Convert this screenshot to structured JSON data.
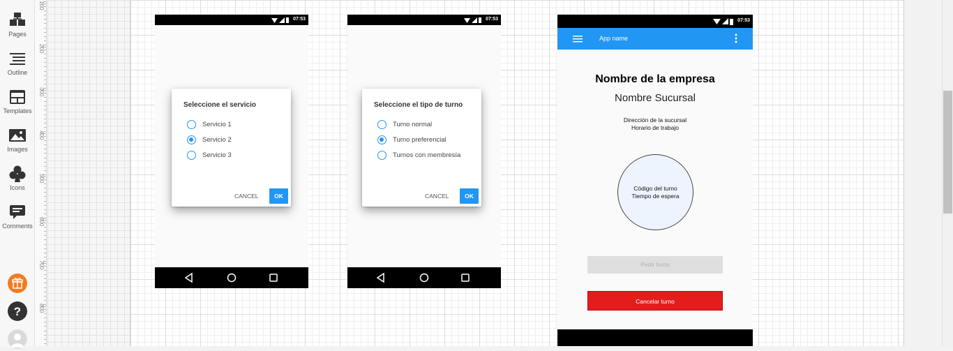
{
  "sidebar": {
    "items": [
      {
        "label": "Pages",
        "icon": "pages-icon"
      },
      {
        "label": "Outline",
        "icon": "outline-icon"
      },
      {
        "label": "Templates",
        "icon": "templates-icon"
      },
      {
        "label": "Images",
        "icon": "images-icon"
      },
      {
        "label": "Icons",
        "icon": "icons-club-icon"
      },
      {
        "label": "Comments",
        "icon": "comments-icon"
      }
    ],
    "bottom": [
      "gift-icon",
      "help-icon",
      "user-avatar-icon"
    ]
  },
  "ruler": {
    "labels": [
      "100",
      "200",
      "300",
      "400",
      "500",
      "600",
      "700",
      "800",
      "90"
    ]
  },
  "phones": {
    "status_time": "07:53",
    "dialog1": {
      "title": "Seleccione el servicio",
      "options": [
        "Servicio 1",
        "Servicio 2",
        "Servicio 3"
      ],
      "selected": 1,
      "cancel": "CANCEL",
      "ok": "OK"
    },
    "dialog2": {
      "title": "Seleccione el tipo de turno",
      "options": [
        "Turno normal",
        "Turno preferencial",
        "Turnos con membresía"
      ],
      "selected": 1,
      "cancel": "CANCEL",
      "ok": "OK"
    },
    "app": {
      "app_name": "App name",
      "company": "Nombre de la empresa",
      "branch": "Nombre Sucursal",
      "address": "Dirección de la sucursal",
      "hours": "Horario de trabajo",
      "turn_code": "Código del turno",
      "wait_time": "Tiempo de espera",
      "request_button": "Pedir turno",
      "cancel_button": "Cancelar turno"
    }
  },
  "colors": {
    "accent": "#2196f3",
    "danger": "#e51c1c",
    "gift": "#f47b20",
    "circle_fill": "#eef4fd"
  }
}
